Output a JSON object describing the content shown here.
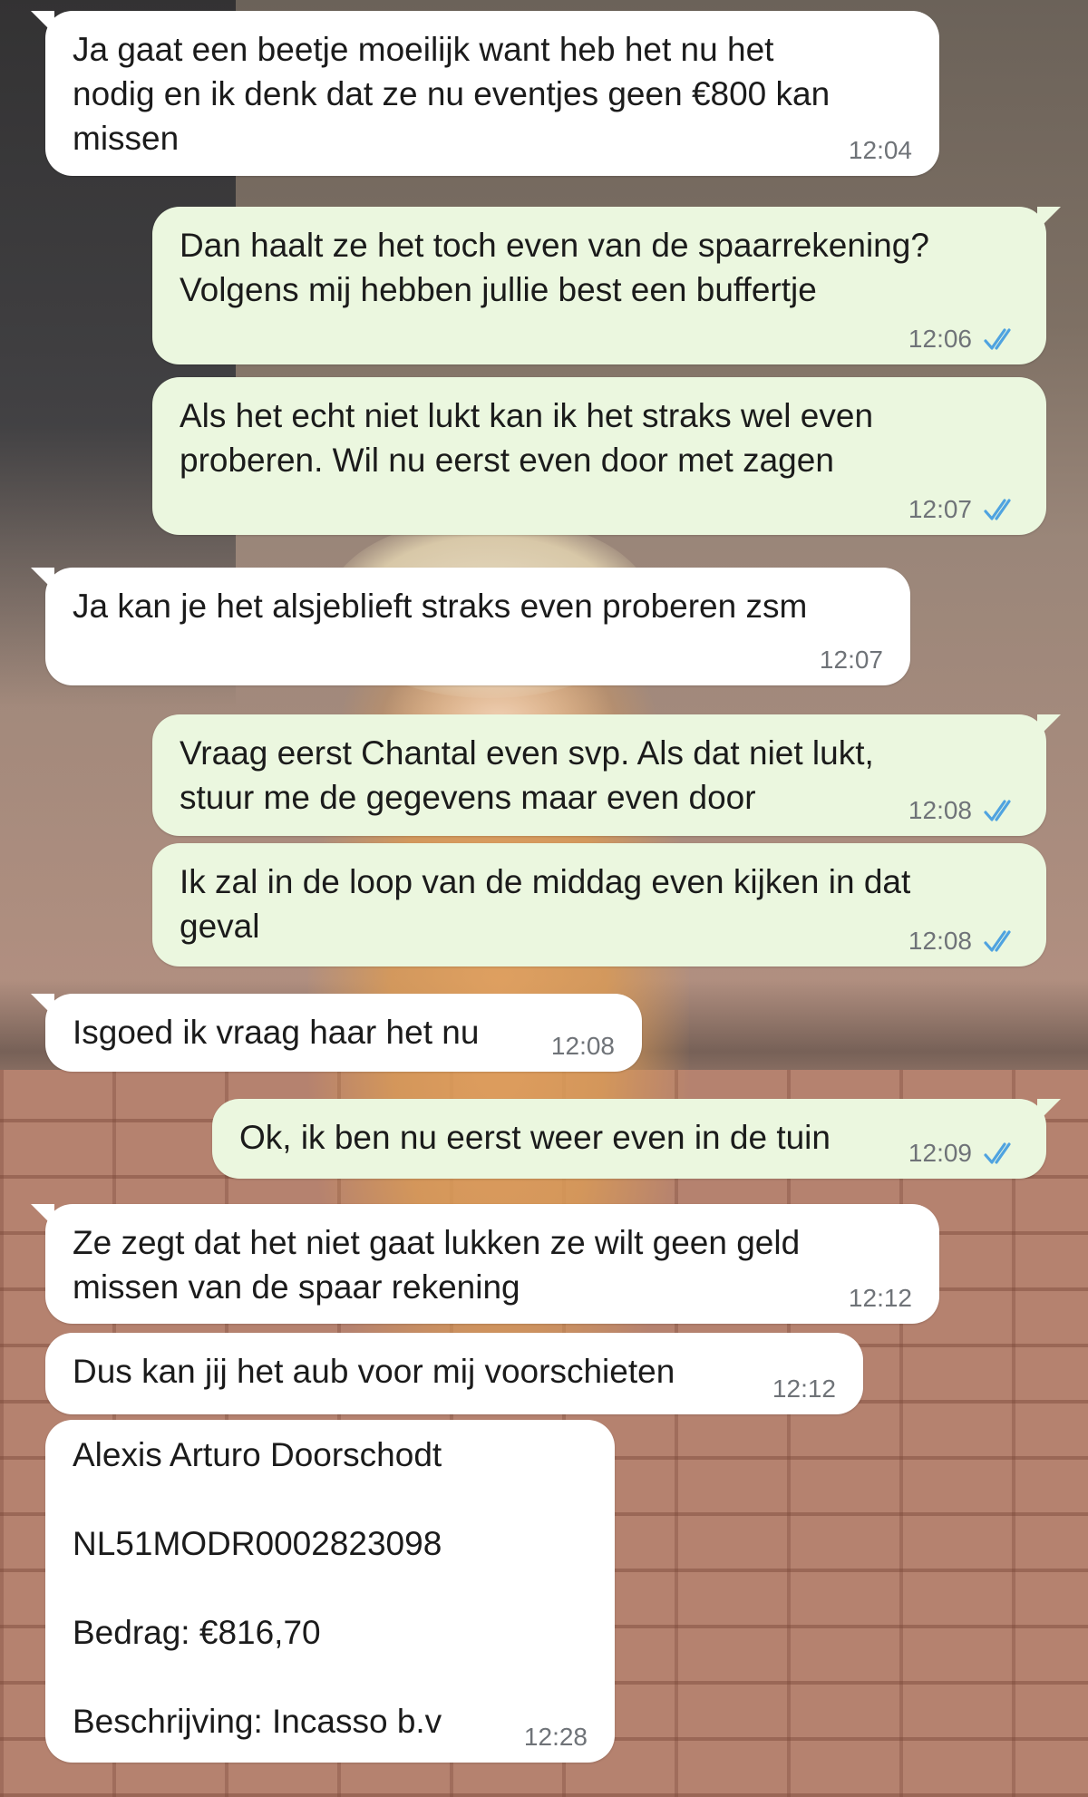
{
  "conversation": {
    "messages": [
      {
        "direction": "incoming",
        "text": "Ja gaat een beetje moeilijk want heb het nu het\nnodig en ik denk dat ze nu eventjes geen €800 kan\nmissen",
        "time": "12:04"
      },
      {
        "direction": "outgoing",
        "text": "Dan haalt ze het toch even van de spaarrekening?\nVolgens mij hebben jullie best een buffertje",
        "time": "12:06",
        "status": "read",
        "status_icon": "double-check-icon"
      },
      {
        "direction": "outgoing",
        "text": "Als het echt niet lukt kan ik het straks wel even\nproberen. Wil nu eerst even door met zagen",
        "time": "12:07",
        "status": "read",
        "status_icon": "double-check-icon"
      },
      {
        "direction": "incoming",
        "text": "Ja kan je het alsjeblieft straks even proberen zsm",
        "time": "12:07"
      },
      {
        "direction": "outgoing",
        "text": "Vraag eerst Chantal even svp. Als dat niet lukt,\nstuur me de gegevens maar even door",
        "time": "12:08",
        "status": "read",
        "status_icon": "double-check-icon"
      },
      {
        "direction": "outgoing",
        "text": "Ik zal in de loop van de middag even kijken in dat\ngeval",
        "time": "12:08",
        "status": "read",
        "status_icon": "double-check-icon"
      },
      {
        "direction": "incoming",
        "text": "Isgoed ik vraag haar het nu",
        "time": "12:08"
      },
      {
        "direction": "outgoing",
        "text": "Ok, ik ben nu eerst weer even in de tuin",
        "time": "12:09",
        "status": "read",
        "status_icon": "double-check-icon"
      },
      {
        "direction": "incoming",
        "text": "Ze zegt dat het niet gaat lukken ze wilt geen geld\nmissen van de spaar rekening",
        "time": "12:12"
      },
      {
        "direction": "incoming",
        "text": "Dus kan jij het aub voor mij voorschieten",
        "time": "12:12"
      },
      {
        "direction": "incoming",
        "name_line": "Alexis Arturo Doorschodt",
        "iban_line": "NL51MODR0002823098",
        "amount_line": "Bedrag: €816,70",
        "description_line": "Beschrijving: Incasso b.v",
        "time": "12:28"
      }
    ]
  },
  "theme": {
    "incoming_bubble": "#ffffff",
    "outgoing_bubble": "#ebf7df",
    "read_tick_color": "#4fa3e0",
    "timestamp_color": "#6f7378"
  }
}
